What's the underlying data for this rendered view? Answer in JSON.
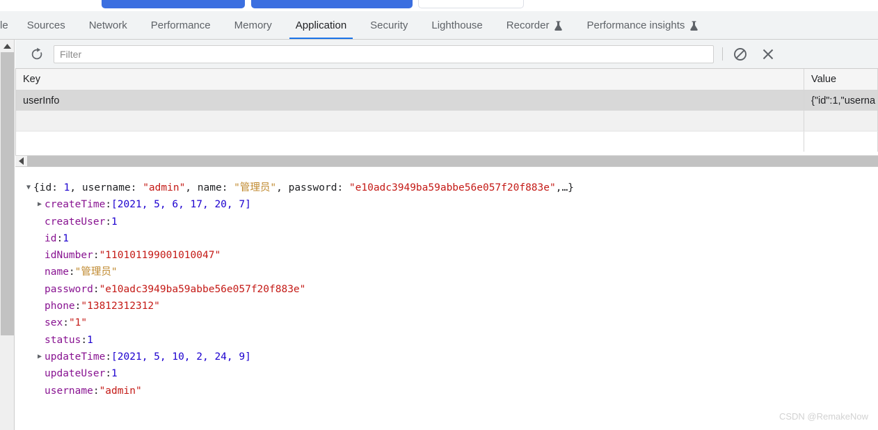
{
  "page_buttons": [
    {
      "label": "",
      "style": "primary"
    },
    {
      "label": "",
      "style": "primary"
    },
    {
      "label": "",
      "style": "default"
    }
  ],
  "tabs": [
    {
      "label": "le",
      "active": false,
      "experimental": false,
      "cut": true
    },
    {
      "label": "Sources",
      "active": false,
      "experimental": false
    },
    {
      "label": "Network",
      "active": false,
      "experimental": false
    },
    {
      "label": "Performance",
      "active": false,
      "experimental": false
    },
    {
      "label": "Memory",
      "active": false,
      "experimental": false
    },
    {
      "label": "Application",
      "active": true,
      "experimental": false
    },
    {
      "label": "Security",
      "active": false,
      "experimental": false
    },
    {
      "label": "Lighthouse",
      "active": false,
      "experimental": false
    },
    {
      "label": "Recorder",
      "active": false,
      "experimental": true
    },
    {
      "label": "Performance insights",
      "active": false,
      "experimental": true
    }
  ],
  "toolbar": {
    "refresh_icon": "refresh-icon",
    "filter_placeholder": "Filter",
    "filter_value": "",
    "clear_icon": "clear-all-icon",
    "delete_icon": "delete-selected-icon"
  },
  "table": {
    "columns": [
      "Key",
      "Value"
    ],
    "rows": [
      {
        "key": "userInfo",
        "value": "{\"id\":1,\"userna",
        "selected": true
      }
    ],
    "empty_rows": 2
  },
  "scrollbars": {
    "horizontal_left_arrow": "scroll-left-arrow-icon",
    "vertical_up_arrow": "scroll-up-arrow-icon"
  },
  "json_preview": {
    "root": {
      "expanded": true,
      "summary_parts": [
        {
          "text": "{",
          "type": "punct"
        },
        {
          "text": "id",
          "type": "key-plain"
        },
        {
          "text": ": ",
          "type": "punct"
        },
        {
          "text": "1",
          "type": "num"
        },
        {
          "text": ", ",
          "type": "punct"
        },
        {
          "text": "username",
          "type": "key-plain"
        },
        {
          "text": ": ",
          "type": "punct"
        },
        {
          "text": "\"admin\"",
          "type": "str"
        },
        {
          "text": ", ",
          "type": "punct"
        },
        {
          "text": "name",
          "type": "key-plain"
        },
        {
          "text": ": ",
          "type": "punct"
        },
        {
          "text": "\"管理员\"",
          "type": "cjk"
        },
        {
          "text": ", ",
          "type": "punct"
        },
        {
          "text": "password",
          "type": "key-plain"
        },
        {
          "text": ": ",
          "type": "punct"
        },
        {
          "text": "\"e10adc3949ba59abbe56e057f20f883e\"",
          "type": "str"
        },
        {
          "text": ",…}",
          "type": "punct"
        }
      ]
    },
    "properties": [
      {
        "expandable": true,
        "key": "createTime",
        "value": "[2021, 5, 6, 17, 20, 7]",
        "value_type": "array",
        "array_items": [
          2021,
          5,
          6,
          17,
          20,
          7
        ]
      },
      {
        "expandable": false,
        "key": "createUser",
        "value": "1",
        "value_type": "num"
      },
      {
        "expandable": false,
        "key": "id",
        "value": "1",
        "value_type": "num"
      },
      {
        "expandable": false,
        "key": "idNumber",
        "value": "\"110101199001010047\"",
        "value_type": "str"
      },
      {
        "expandable": false,
        "key": "name",
        "value": "\"管理员\"",
        "value_type": "cjk"
      },
      {
        "expandable": false,
        "key": "password",
        "value": "\"e10adc3949ba59abbe56e057f20f883e\"",
        "value_type": "str"
      },
      {
        "expandable": false,
        "key": "phone",
        "value": "\"13812312312\"",
        "value_type": "str"
      },
      {
        "expandable": false,
        "key": "sex",
        "value": "\"1\"",
        "value_type": "str"
      },
      {
        "expandable": false,
        "key": "status",
        "value": "1",
        "value_type": "num"
      },
      {
        "expandable": true,
        "key": "updateTime",
        "value": "[2021, 5, 10, 2, 24, 9]",
        "value_type": "array",
        "array_items": [
          2021,
          5,
          10,
          2,
          24,
          9
        ]
      },
      {
        "expandable": false,
        "key": "updateUser",
        "value": "1",
        "value_type": "num"
      },
      {
        "expandable": false,
        "key": "username",
        "value": "\"admin\"",
        "value_type": "str"
      }
    ]
  },
  "watermark": "CSDN @RemakeNow",
  "colors": {
    "accent": "#1a73e8",
    "button_blue": "#3b6fe0",
    "panel_bg": "#f1f3f4",
    "key_purple": "#881391",
    "string_red": "#c41a16",
    "number_blue": "#1c00cf",
    "cjk_gold": "#c08a30",
    "selected_row": "#d8d8d8"
  }
}
